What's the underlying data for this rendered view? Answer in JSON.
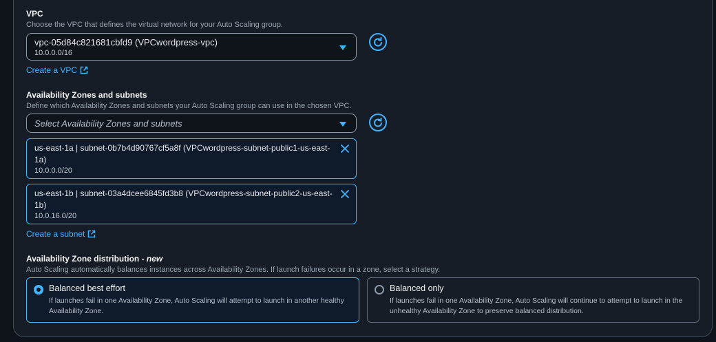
{
  "vpc": {
    "label": "VPC",
    "description": "Choose the VPC that defines the virtual network for your Auto Scaling group.",
    "selected_value": "vpc-05d84c821681cbfd9 (VPCwordpress-vpc)",
    "selected_cidr": "10.0.0.0/16",
    "create_link": "Create a VPC"
  },
  "subnets": {
    "label": "Availability Zones and subnets",
    "description": "Define which Availability Zones and subnets your Auto Scaling group can use in the chosen VPC.",
    "placeholder": "Select Availability Zones and subnets",
    "tokens": [
      {
        "name": "us-east-1a | subnet-0b7b4d90767cf5a8f (VPCwordpress-subnet-public1-us-east-1a)",
        "cidr": "10.0.0.0/20"
      },
      {
        "name": "us-east-1b | subnet-03a4dcee6845fd3b8 (VPCwordpress-subnet-public2-us-east-1b)",
        "cidr": "10.0.16.0/20"
      }
    ],
    "create_link": "Create a subnet"
  },
  "az_distribution": {
    "label": "Availability Zone distribution - ",
    "label_new": "new",
    "description": "Auto Scaling automatically balances instances across Availability Zones. If launch failures occur in a zone, select a strategy.",
    "options": [
      {
        "title": "Balanced best effort",
        "description": "If launches fail in one Availability Zone, Auto Scaling will attempt to launch in another healthy Availability Zone.",
        "selected": true
      },
      {
        "title": "Balanced only",
        "description": "If launches fail in one Availability Zone, Auto Scaling will continue to attempt to launch in the unhealthy Availability Zone to preserve balanced distribution.",
        "selected": false
      }
    ]
  },
  "colors": {
    "accent": "#42b4ff",
    "background": "#0f141a",
    "panel": "#161d26"
  },
  "icons": [
    "refresh-icon",
    "external-link-icon",
    "close-icon",
    "caret-down-icon"
  ]
}
